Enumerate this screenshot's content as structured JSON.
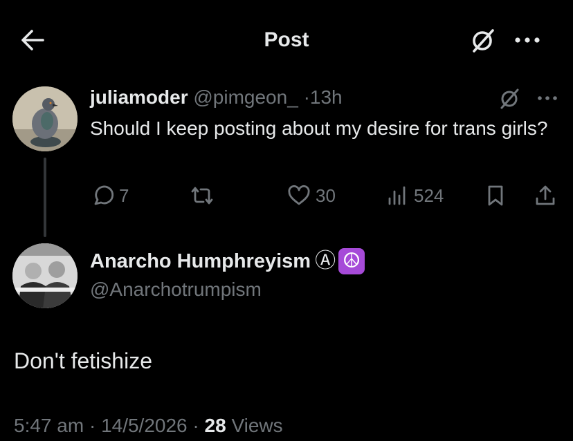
{
  "header": {
    "title": "Post",
    "icons": {
      "back": "arrow-left-icon",
      "grok": "grok-icon",
      "more": "more-horizontal-icon"
    }
  },
  "reply_to": {
    "display_name": "juliamoder",
    "handle": "@pimgeon_",
    "separator": "·",
    "time": "13h",
    "text": "Should I keep posting about my desire for trans girls?",
    "avatar": "pigeon-avatar",
    "stats": {
      "replies": "7",
      "reposts": "",
      "likes": "30",
      "views": "524"
    }
  },
  "tweet": {
    "display_name": "Anarcho Humphreyism",
    "name_symbol": "Ⓐ",
    "name_emoji": "☮",
    "handle": "@Anarchotrumpism",
    "avatar": "photo-avatar",
    "text": "Don't fetishize",
    "time": "5:47 am",
    "date": "14/5/2026",
    "separator": "·",
    "views_count": "28",
    "views_label": "Views"
  },
  "colors": {
    "background": "#000000",
    "text_primary": "#e7e9ea",
    "text_muted": "#71767b",
    "thread_line": "#333639",
    "peace_emoji_bg": "#a64ad8"
  }
}
